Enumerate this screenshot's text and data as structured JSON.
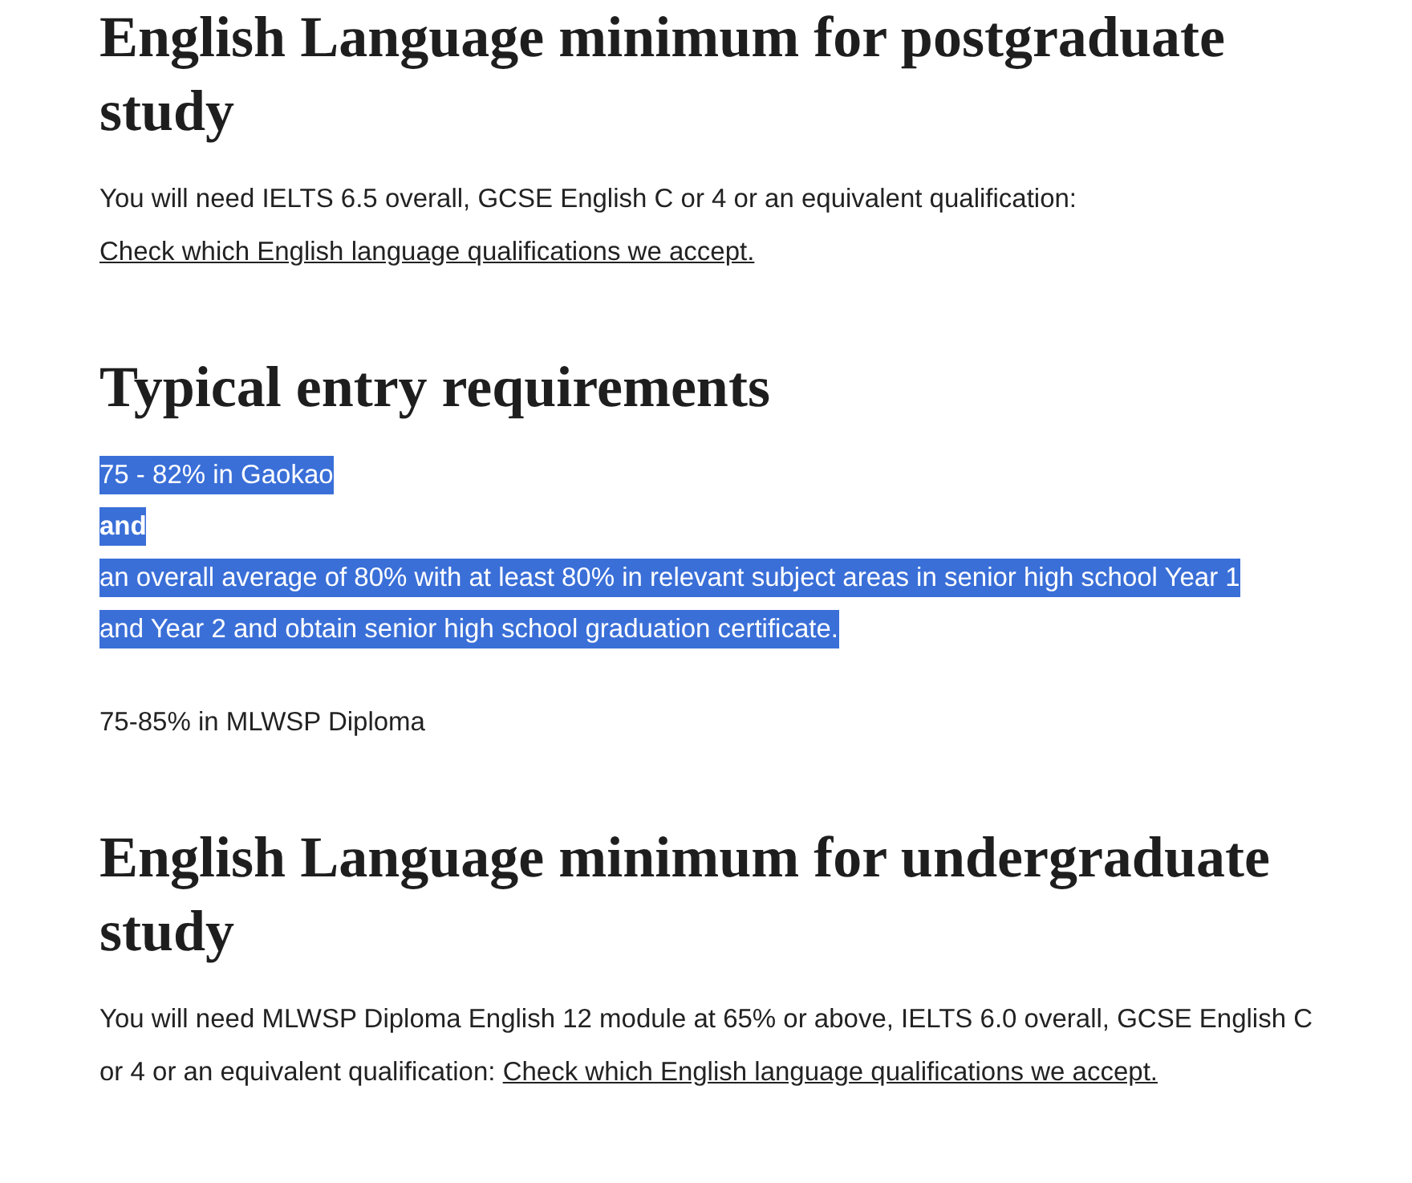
{
  "sections": [
    {
      "heading": "English Language minimum for postgraduate study",
      "blocks": [
        {
          "kind": "paragraph",
          "text": "You will need IELTS 6.5 overall, GCSE English C or 4 or an equivalent qualification: ",
          "link": "Check which English language qualifications we accept."
        }
      ]
    },
    {
      "heading": "Typical entry requirements",
      "blocks": [
        {
          "kind": "lines",
          "selected": true,
          "lines": [
            {
              "text": "75 - 82% in Gaokao",
              "bold": false
            },
            {
              "text": "and",
              "bold": true
            },
            {
              "text": "an overall average of 80% with at least 80% in relevant subject areas in senior high school Year 1",
              "bold": false
            },
            {
              "text": "and Year 2 and obtain senior high school graduation certificate.",
              "bold": false
            }
          ]
        },
        {
          "kind": "paragraph",
          "text": "75-85% in MLWSP Diploma"
        }
      ]
    },
    {
      "heading": "English Language minimum for undergraduate study",
      "blocks": [
        {
          "kind": "paragraph",
          "text": "You will need MLWSP Diploma English 12 module at 65% or above, IELTS 6.0 overall, GCSE English C or 4 or an equivalent qualification: ",
          "link": "Check which English language qualifications we accept."
        }
      ]
    }
  ]
}
